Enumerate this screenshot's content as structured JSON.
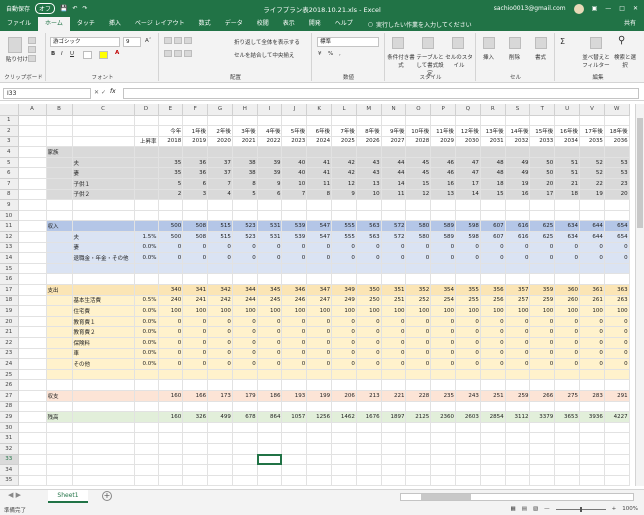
{
  "titlebar": {
    "autosave": "自動保存",
    "autosave_state": "オフ",
    "title": "ライフプラン表2018.10.21.xls  -  Excel",
    "account": "sachio0013@gmail.com"
  },
  "menu": {
    "tabs": [
      "ファイル",
      "ホーム",
      "タッチ",
      "挿入",
      "ページ レイアウト",
      "数式",
      "データ",
      "校閲",
      "表示",
      "開発",
      "ヘルプ"
    ],
    "search_placeholder": "実行したい作業を入力してください",
    "share": "共有"
  },
  "ribbon": {
    "clipboard": {
      "paste": "貼り付け",
      "label": "クリップボード"
    },
    "font": {
      "name": "游ゴシック",
      "size": "9",
      "label": "フォント"
    },
    "alignment": {
      "wrap": "折り返して全体を表示する",
      "merge": "セルを結合して中央揃え",
      "label": "配置"
    },
    "number": {
      "format": "標準",
      "label": "数値"
    },
    "styles": {
      "conditional": "条件付き書式",
      "table": "テーブルとして書式設定",
      "cell": "セルのスタイル",
      "label": "スタイル"
    },
    "cells": {
      "insert": "挿入",
      "delete": "削除",
      "format": "書式",
      "label": "セル"
    },
    "editing": {
      "sort": "並べ替えとフィルター",
      "find": "検索と選択",
      "label": "編集"
    }
  },
  "formula": {
    "namebox": "I33",
    "fx": "fx",
    "value": ""
  },
  "grid": {
    "selected_cell": "I33",
    "columns": [
      "A",
      "B",
      "C",
      "D",
      "E",
      "F",
      "G",
      "H",
      "I",
      "J",
      "K",
      "L",
      "M",
      "N",
      "O",
      "P",
      "Q",
      "R",
      "S",
      "T",
      "U",
      "V",
      "W"
    ],
    "rows": [
      {
        "n": "1",
        "cells": [
          "",
          "",
          "",
          "",
          "",
          "",
          "",
          "",
          "",
          "",
          "",
          "",
          "",
          "",
          "",
          "",
          "",
          "",
          "",
          "",
          "",
          "",
          ""
        ]
      },
      {
        "n": "2",
        "cells": [
          "",
          "",
          "",
          "",
          "今年",
          "1年後",
          "2年後",
          "3年後",
          "4年後",
          "5年後",
          "6年後",
          "7年後",
          "8年後",
          "9年後",
          "10年後",
          "11年後",
          "12年後",
          "13年後",
          "14年後",
          "15年後",
          "16年後",
          "17年後",
          "18年後"
        ]
      },
      {
        "n": "3",
        "cells": [
          "",
          "",
          "",
          "上昇率",
          "2018",
          "2019",
          "2020",
          "2021",
          "2022",
          "2023",
          "2024",
          "2025",
          "2026",
          "2027",
          "2028",
          "2029",
          "2030",
          "2031",
          "2032",
          "2033",
          "2034",
          "2035",
          "2036"
        ]
      },
      {
        "n": "4",
        "cells": [
          "",
          "家族",
          "",
          "",
          "",
          "",
          "",
          "",
          "",
          "",
          "",
          "",
          "",
          "",
          "",
          "",
          "",
          "",
          "",
          "",
          "",
          "",
          ""
        ]
      },
      {
        "n": "5",
        "cells": [
          "",
          "",
          "夫",
          "",
          "35",
          "36",
          "37",
          "38",
          "39",
          "40",
          "41",
          "42",
          "43",
          "44",
          "45",
          "46",
          "47",
          "48",
          "49",
          "50",
          "51",
          "52",
          "53"
        ]
      },
      {
        "n": "6",
        "cells": [
          "",
          "",
          "妻",
          "",
          "35",
          "36",
          "37",
          "38",
          "39",
          "40",
          "41",
          "42",
          "43",
          "44",
          "45",
          "46",
          "47",
          "48",
          "49",
          "50",
          "51",
          "52",
          "53"
        ]
      },
      {
        "n": "7",
        "cells": [
          "",
          "",
          "子供１",
          "",
          "5",
          "6",
          "7",
          "8",
          "9",
          "10",
          "11",
          "12",
          "13",
          "14",
          "15",
          "16",
          "17",
          "18",
          "19",
          "20",
          "21",
          "22",
          "23"
        ]
      },
      {
        "n": "8",
        "cells": [
          "",
          "",
          "子供２",
          "",
          "2",
          "3",
          "4",
          "5",
          "6",
          "7",
          "8",
          "9",
          "10",
          "11",
          "12",
          "13",
          "14",
          "15",
          "16",
          "17",
          "18",
          "19",
          "20"
        ]
      },
      {
        "n": "9",
        "cells": [
          "",
          "",
          "",
          "",
          "",
          "",
          "",
          "",
          "",
          "",
          "",
          "",
          "",
          "",
          "",
          "",
          "",
          "",
          "",
          "",
          "",
          "",
          ""
        ]
      },
      {
        "n": "10",
        "cells": [
          "",
          "",
          "",
          "",
          "",
          "",
          "",
          "",
          "",
          "",
          "",
          "",
          "",
          "",
          "",
          "",
          "",
          "",
          "",
          "",
          "",
          "",
          ""
        ]
      },
      {
        "n": "11",
        "cells": [
          "",
          "収入",
          "",
          "",
          "500",
          "508",
          "515",
          "523",
          "531",
          "539",
          "547",
          "555",
          "563",
          "572",
          "580",
          "589",
          "598",
          "607",
          "616",
          "625",
          "634",
          "644",
          "654"
        ]
      },
      {
        "n": "12",
        "cells": [
          "",
          "",
          "夫",
          "1.5%",
          "500",
          "508",
          "515",
          "523",
          "531",
          "539",
          "547",
          "555",
          "563",
          "572",
          "580",
          "589",
          "598",
          "607",
          "616",
          "625",
          "634",
          "644",
          "654"
        ]
      },
      {
        "n": "13",
        "cells": [
          "",
          "",
          "妻",
          "0.0%",
          "0",
          "0",
          "0",
          "0",
          "0",
          "0",
          "0",
          "0",
          "0",
          "0",
          "0",
          "0",
          "0",
          "0",
          "0",
          "0",
          "0",
          "0",
          "0"
        ]
      },
      {
        "n": "14",
        "cells": [
          "",
          "",
          "退職金・年金・その他",
          "0.0%",
          "0",
          "0",
          "0",
          "0",
          "0",
          "0",
          "0",
          "0",
          "0",
          "0",
          "0",
          "0",
          "0",
          "0",
          "0",
          "0",
          "0",
          "0",
          "0"
        ]
      },
      {
        "n": "15",
        "cells": [
          "",
          "",
          "",
          "",
          "",
          "",
          "",
          "",
          "",
          "",
          "",
          "",
          "",
          "",
          "",
          "",
          "",
          "",
          "",
          "",
          "",
          "",
          ""
        ]
      },
      {
        "n": "16",
        "cells": [
          "",
          "",
          "",
          "",
          "",
          "",
          "",
          "",
          "",
          "",
          "",
          "",
          "",
          "",
          "",
          "",
          "",
          "",
          "",
          "",
          "",
          "",
          ""
        ]
      },
      {
        "n": "17",
        "cells": [
          "",
          "支出",
          "",
          "",
          "340",
          "341",
          "342",
          "344",
          "345",
          "346",
          "347",
          "349",
          "350",
          "351",
          "352",
          "354",
          "355",
          "356",
          "357",
          "359",
          "360",
          "361",
          "363"
        ]
      },
      {
        "n": "18",
        "cells": [
          "",
          "",
          "基本生活費",
          "0.5%",
          "240",
          "241",
          "242",
          "244",
          "245",
          "246",
          "247",
          "249",
          "250",
          "251",
          "252",
          "254",
          "255",
          "256",
          "257",
          "259",
          "260",
          "261",
          "263"
        ]
      },
      {
        "n": "19",
        "cells": [
          "",
          "",
          "住宅費",
          "0.0%",
          "100",
          "100",
          "100",
          "100",
          "100",
          "100",
          "100",
          "100",
          "100",
          "100",
          "100",
          "100",
          "100",
          "100",
          "100",
          "100",
          "100",
          "100",
          "100"
        ]
      },
      {
        "n": "20",
        "cells": [
          "",
          "",
          "教育費１",
          "0.0%",
          "0",
          "0",
          "0",
          "0",
          "0",
          "0",
          "0",
          "0",
          "0",
          "0",
          "0",
          "0",
          "0",
          "0",
          "0",
          "0",
          "0",
          "0",
          "0"
        ]
      },
      {
        "n": "21",
        "cells": [
          "",
          "",
          "教育費２",
          "0.0%",
          "0",
          "0",
          "0",
          "0",
          "0",
          "0",
          "0",
          "0",
          "0",
          "0",
          "0",
          "0",
          "0",
          "0",
          "0",
          "0",
          "0",
          "0",
          "0"
        ]
      },
      {
        "n": "22",
        "cells": [
          "",
          "",
          "保険料",
          "0.0%",
          "0",
          "0",
          "0",
          "0",
          "0",
          "0",
          "0",
          "0",
          "0",
          "0",
          "0",
          "0",
          "0",
          "0",
          "0",
          "0",
          "0",
          "0",
          "0"
        ]
      },
      {
        "n": "23",
        "cells": [
          "",
          "",
          "車",
          "0.0%",
          "0",
          "0",
          "0",
          "0",
          "0",
          "0",
          "0",
          "0",
          "0",
          "0",
          "0",
          "0",
          "0",
          "0",
          "0",
          "0",
          "0",
          "0",
          "0"
        ]
      },
      {
        "n": "24",
        "cells": [
          "",
          "",
          "その他",
          "0.0%",
          "0",
          "0",
          "0",
          "0",
          "0",
          "0",
          "0",
          "0",
          "0",
          "0",
          "0",
          "0",
          "0",
          "0",
          "0",
          "0",
          "0",
          "0",
          "0"
        ]
      },
      {
        "n": "25",
        "cells": [
          "",
          "",
          "",
          "",
          "",
          "",
          "",
          "",
          "",
          "",
          "",
          "",
          "",
          "",
          "",
          "",
          "",
          "",
          "",
          "",
          "",
          "",
          ""
        ]
      },
      {
        "n": "26",
        "cells": [
          "",
          "",
          "",
          "",
          "",
          "",
          "",
          "",
          "",
          "",
          "",
          "",
          "",
          "",
          "",
          "",
          "",
          "",
          "",
          "",
          "",
          "",
          ""
        ]
      },
      {
        "n": "27",
        "cells": [
          "",
          "収支",
          "",
          "",
          "160",
          "166",
          "173",
          "179",
          "186",
          "193",
          "199",
          "206",
          "213",
          "221",
          "228",
          "235",
          "243",
          "251",
          "259",
          "266",
          "275",
          "283",
          "291"
        ]
      },
      {
        "n": "28",
        "cells": [
          "",
          "",
          "",
          "",
          "",
          "",
          "",
          "",
          "",
          "",
          "",
          "",
          "",
          "",
          "",
          "",
          "",
          "",
          "",
          "",
          "",
          "",
          ""
        ]
      },
      {
        "n": "29",
        "cells": [
          "",
          "残高",
          "",
          "",
          "160",
          "326",
          "499",
          "678",
          "864",
          "1057",
          "1256",
          "1462",
          "1676",
          "1897",
          "2125",
          "2360",
          "2603",
          "2854",
          "3112",
          "3379",
          "3653",
          "3936",
          "4227"
        ]
      },
      {
        "n": "30",
        "cells": [
          "",
          "",
          "",
          "",
          "",
          "",
          "",
          "",
          "",
          "",
          "",
          "",
          "",
          "",
          "",
          "",
          "",
          "",
          "",
          "",
          "",
          "",
          ""
        ]
      },
      {
        "n": "31",
        "cells": [
          "",
          "",
          "",
          "",
          "",
          "",
          "",
          "",
          "",
          "",
          "",
          "",
          "",
          "",
          "",
          "",
          "",
          "",
          "",
          "",
          "",
          "",
          ""
        ]
      },
      {
        "n": "32",
        "cells": [
          "",
          "",
          "",
          "",
          "",
          "",
          "",
          "",
          "",
          "",
          "",
          "",
          "",
          "",
          "",
          "",
          "",
          "",
          "",
          "",
          "",
          "",
          ""
        ]
      },
      {
        "n": "33",
        "cells": [
          "",
          "",
          "",
          "",
          "",
          "",
          "",
          "",
          "",
          "",
          "",
          "",
          "",
          "",
          "",
          "",
          "",
          "",
          "",
          "",
          "",
          "",
          ""
        ]
      },
      {
        "n": "34",
        "cells": [
          "",
          "",
          "",
          "",
          "",
          "",
          "",
          "",
          "",
          "",
          "",
          "",
          "",
          "",
          "",
          "",
          "",
          "",
          "",
          "",
          "",
          "",
          ""
        ]
      },
      {
        "n": "35",
        "cells": [
          "",
          "",
          "",
          "",
          "",
          "",
          "",
          "",
          "",
          "",
          "",
          "",
          "",
          "",
          "",
          "",
          "",
          "",
          "",
          "",
          "",
          "",
          ""
        ]
      }
    ]
  },
  "sheet_tabs": {
    "active": "Sheet1",
    "add": "+"
  },
  "status": {
    "ready": "準備完了",
    "zoom": "100%"
  }
}
